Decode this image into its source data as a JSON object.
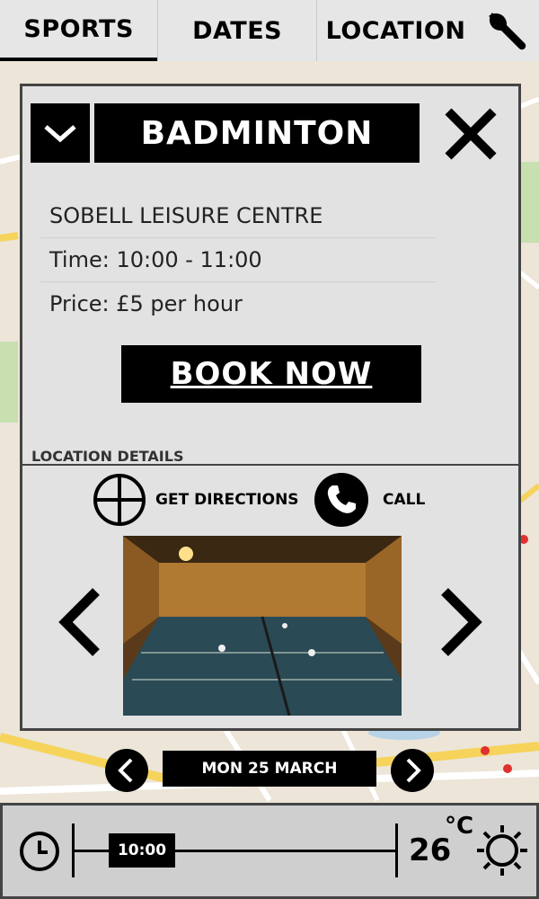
{
  "tabs": {
    "sports": "SPORTS",
    "dates": "DATES",
    "location": "LOCATION",
    "settings_icon": "wrench-icon"
  },
  "card": {
    "title": "BADMINTON",
    "dropdown_icon": "chevron-down-icon",
    "close_icon": "close-icon",
    "venue": "SOBELL LEISURE CENTRE",
    "time": "Time: 10:00 - 11:00",
    "price": "Price: £5 per hour",
    "book_label": "BOOK NOW",
    "location_details_label": "LOCATION DETAILS",
    "directions_label": "GET DIRECTIONS",
    "directions_icon": "crosshair-icon",
    "call_label": "CALL",
    "call_icon": "phone-icon",
    "photo_prev_icon": "chevron-left-icon",
    "photo_next_icon": "chevron-right-icon"
  },
  "date_selector": {
    "label": "MON 25 MARCH",
    "prev_icon": "chevron-left-icon",
    "next_icon": "chevron-right-icon"
  },
  "bottom_bar": {
    "clock_icon": "clock-icon",
    "time_value": "10:00",
    "temperature": "26",
    "temperature_unit": "°C",
    "weather_icon": "sun-icon"
  },
  "colors": {
    "map_background": "#ece5d8",
    "panel": "#e2e2e2",
    "accent": "#000000"
  }
}
